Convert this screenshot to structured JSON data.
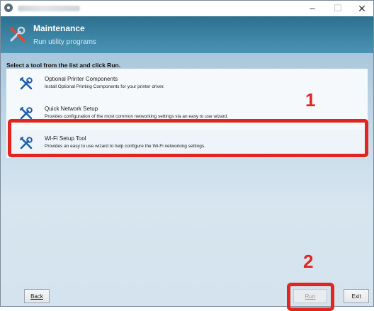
{
  "window": {
    "min_glyph": "–",
    "max_glyph": "☐",
    "close_glyph": "✕"
  },
  "header": {
    "title": "Maintenance",
    "subtitle": "Run utility programs",
    "icon": "tools-icon"
  },
  "main": {
    "instruction": "Select a tool from the list and click Run.",
    "tools": [
      {
        "title": "Optional Printer Components",
        "description": "Install Optional Printing Components for your printer driver.",
        "icon": "tools-icon"
      },
      {
        "title": "Quick Network Setup",
        "description": "Provides configuration of the most common networking settings via an easy to use wizard.",
        "icon": "tools-icon"
      },
      {
        "title": "Wi-Fi Setup Tool",
        "description": "Provides an easy to use wizard to help configure the Wi-Fi networking settings.",
        "icon": "tools-icon"
      }
    ]
  },
  "annotations": {
    "step1": "1",
    "step2": "2",
    "color": "#e0261f"
  },
  "buttons": {
    "back": "Back",
    "run": "Run",
    "exit": "Exit"
  }
}
